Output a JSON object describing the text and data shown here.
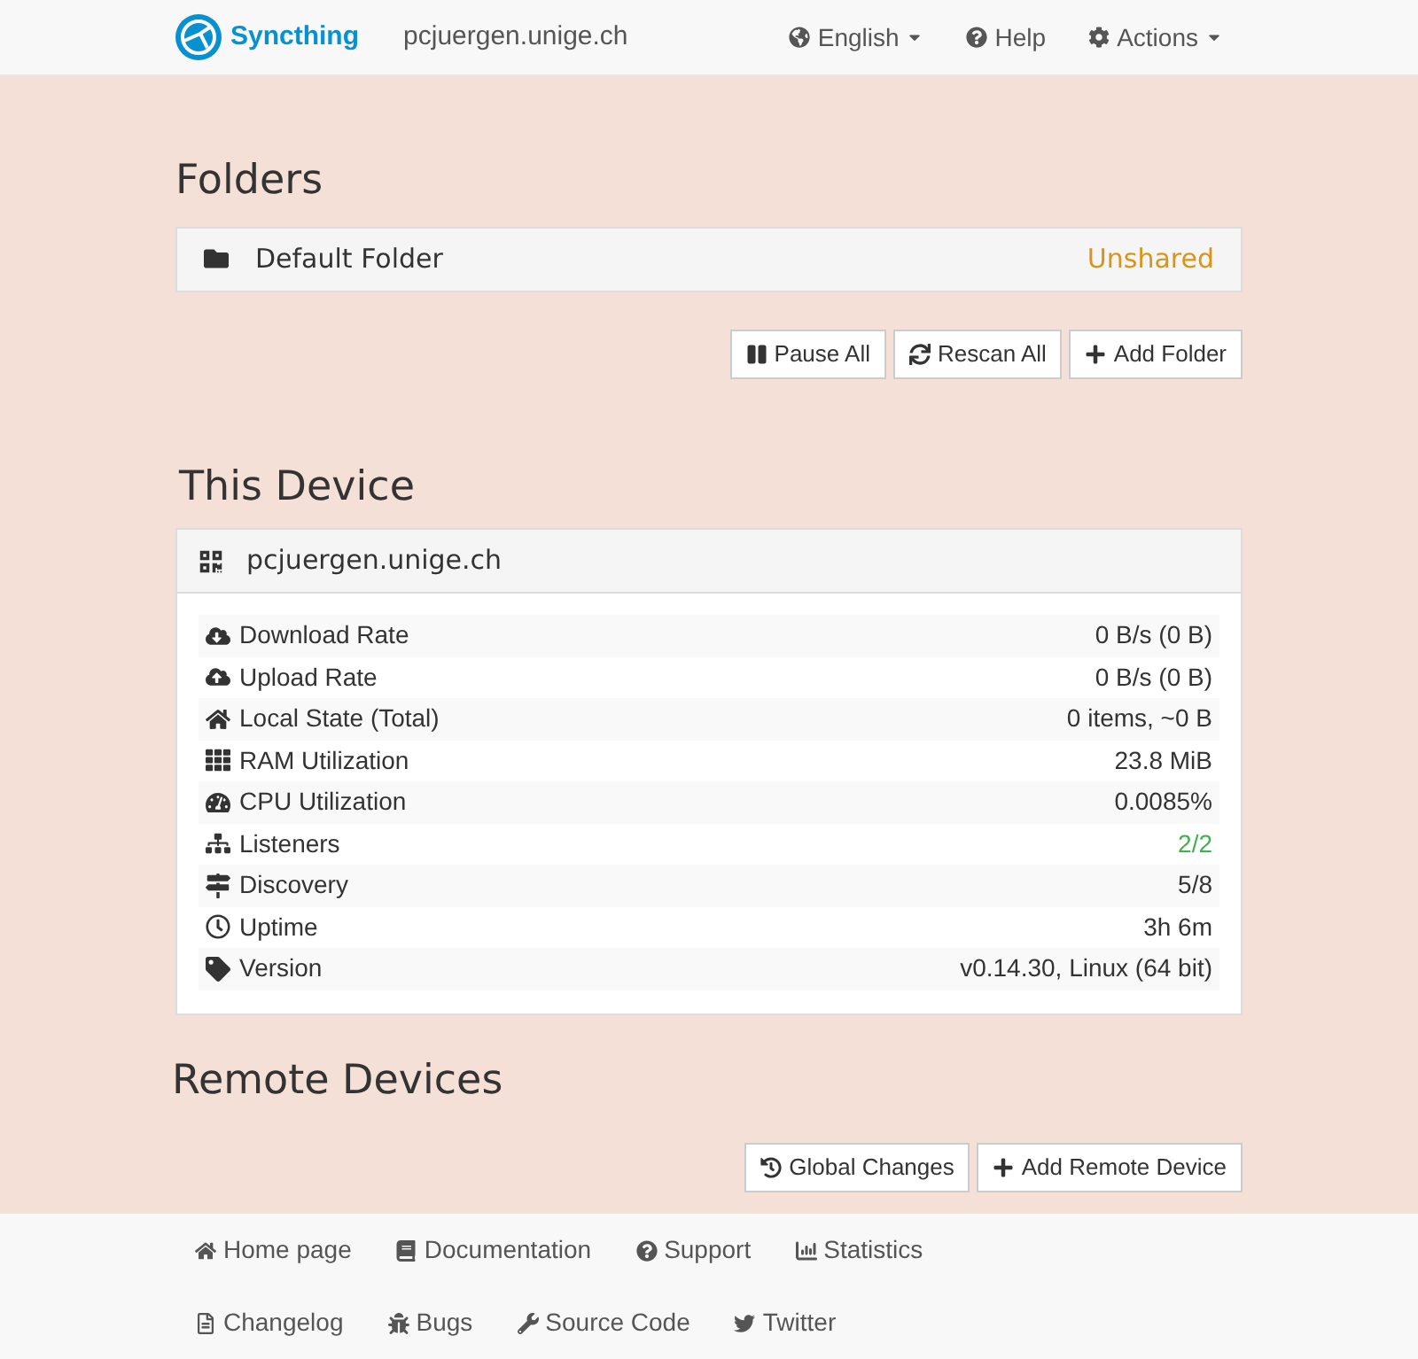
{
  "navbar": {
    "brand": "Syncthing",
    "device_name": "pcjuergen.unige.ch",
    "menus": [
      {
        "label": "English",
        "dropdown": true
      },
      {
        "label": "Help",
        "dropdown": false
      },
      {
        "label": "Actions",
        "dropdown": true
      }
    ]
  },
  "folders": {
    "title": "Folders",
    "items": [
      {
        "name": "Default Folder",
        "status": "Unshared",
        "color": "#d9951a"
      }
    ],
    "buttons": [
      "Pause All",
      "Rescan All",
      "Add Folder"
    ]
  },
  "this_device": {
    "title": "This Device",
    "name": "pcjuergen.unige.ch",
    "stats": [
      {
        "label": "Download Rate",
        "value": "0 B/s (0 B)",
        "color": "#333333"
      },
      {
        "label": "Upload Rate",
        "value": "0 B/s (0 B)",
        "color": "#333333"
      },
      {
        "label": "Local State (Total)",
        "value": "0 items, ~0 B",
        "color": "#333333"
      },
      {
        "label": "RAM Utilization",
        "value": "23.8 MiB",
        "color": "#333333"
      },
      {
        "label": "CPU Utilization",
        "value": "0.0085%",
        "color": "#333333"
      },
      {
        "label": "Listeners",
        "value": "2/2",
        "color": "#3cb44b"
      },
      {
        "label": "Discovery",
        "value": "5/8",
        "color": "#333333"
      },
      {
        "label": "Uptime",
        "value": "3h 6m",
        "color": "#333333"
      },
      {
        "label": "Version",
        "value": "v0.14.30, Linux (64 bit)",
        "color": "#333333"
      }
    ]
  },
  "remote_devices": {
    "title": "Remote Devices",
    "buttons": [
      "Global Changes",
      "Add Remote Device"
    ]
  },
  "footer": {
    "links": [
      "Home page",
      "Documentation",
      "Support",
      "Statistics",
      "Changelog",
      "Bugs",
      "Source Code",
      "Twitter"
    ]
  }
}
